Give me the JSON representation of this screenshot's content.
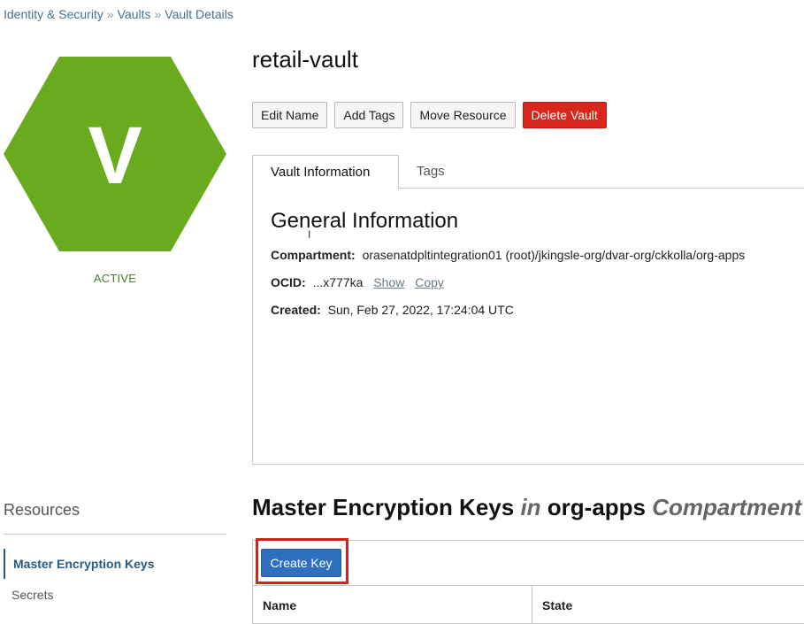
{
  "breadcrumb": {
    "items": [
      "Identity & Security",
      "Vaults",
      "Vault Details"
    ],
    "separator": "»"
  },
  "vault": {
    "initial": "V",
    "status": "ACTIVE",
    "name": "retail-vault",
    "badge_color": "#6aaa1e"
  },
  "toolbar": {
    "edit_name": "Edit Name",
    "add_tags": "Add Tags",
    "move_resource": "Move Resource",
    "delete_vault": "Delete Vault"
  },
  "tabs": [
    {
      "label": "Vault Information",
      "active": true
    },
    {
      "label": "Tags",
      "active": false
    }
  ],
  "general_info": {
    "title": "General Information",
    "compartment_label": "Compartment:",
    "compartment_value": "orasenatdpltintegration01 (root)/jkingsle-org/dvar-org/ckkolla/org-apps",
    "ocid_label": "OCID:",
    "ocid_value": "...x777ka",
    "show_link": "Show",
    "copy_link": "Copy",
    "created_label": "Created:",
    "created_value": "Sun, Feb 27, 2022, 17:24:04 UTC"
  },
  "resources": {
    "title": "Resources",
    "items": [
      {
        "label": "Master Encryption Keys",
        "active": true
      },
      {
        "label": "Secrets",
        "active": false
      }
    ]
  },
  "keys_section": {
    "title_main": "Master Encryption Keys",
    "title_in": "in",
    "title_compartment": "org-apps",
    "title_suffix": "Compartment",
    "create_button": "Create Key",
    "columns": [
      "Name",
      "State"
    ]
  },
  "colors": {
    "primary": "#2f6fbf",
    "danger": "#d9261c",
    "highlight": "#d6201a",
    "active_status": "#4d7a2f"
  }
}
